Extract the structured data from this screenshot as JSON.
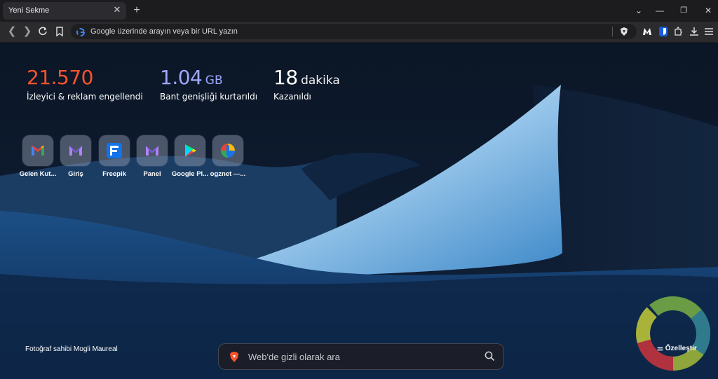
{
  "tab": {
    "title": "Yeni Sekme"
  },
  "omnibox": {
    "placeholder": "Google üzerinde arayın veya bir URL yazın"
  },
  "stats": [
    {
      "value": "21.570",
      "unit": "",
      "label": "İzleyici & reklam engellendi",
      "color": "#fb542b"
    },
    {
      "value": "1.04",
      "unit": "GB",
      "label": "Bant genişliği kurtarıldı",
      "color": "#a0a8ff"
    },
    {
      "value": "18",
      "unit": "dakika",
      "label": "Kazanıldı",
      "color": "#ffffff"
    }
  ],
  "top_sites": [
    {
      "label": "Gelen Kut...",
      "icon": "gmail-icon"
    },
    {
      "label": "Giriş",
      "icon": "proton-mail-icon"
    },
    {
      "label": "Freepik",
      "icon": "freepik-icon"
    },
    {
      "label": "Panel",
      "icon": "proton-mail-icon"
    },
    {
      "label": "Google Pl...",
      "icon": "google-play-icon"
    },
    {
      "label": "ogznet —...",
      "icon": "ogznet-icon"
    }
  ],
  "search": {
    "placeholder": "Web'de gizli olarak ara"
  },
  "photo_credit": "Fotoğraf sahibi Mogli Maureal",
  "customize_label": "Özelleştir",
  "colors": {
    "tabstrip": "#1c1c1f",
    "toolbar": "#2b2b2e",
    "accent_orange": "#fb542b",
    "accent_purple": "#a0a8ff"
  }
}
